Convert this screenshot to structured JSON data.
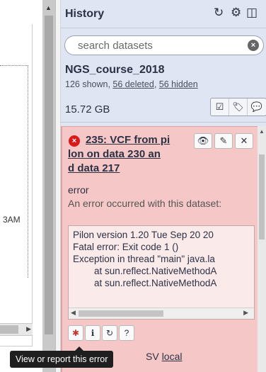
{
  "center": {
    "partial_label": "3AM"
  },
  "history": {
    "title": "History",
    "icons": {
      "refresh": "↻",
      "settings": "⚙",
      "columns": "◫"
    },
    "search": {
      "placeholder": "search datasets",
      "clear": "×"
    },
    "name": "NGS_course_2018",
    "counts": {
      "shown": "126 shown, ",
      "deleted": "56 deleted",
      "sep": ", ",
      "hidden": "56 hidden"
    },
    "size": "15.72 GB",
    "action_icons": {
      "select": "☑",
      "tags": "🏷",
      "annotate": "💬"
    }
  },
  "dataset": {
    "error_icon": "×",
    "title_line1": "235: VCF from pi",
    "title_line2": "lon on data 230 an",
    "title_line3": "d data 217",
    "action_icons": {
      "view": "👁",
      "edit": "✎",
      "delete": "✕"
    },
    "state": "error",
    "message": "An error occurred with this dataset:",
    "peek_lines": [
      "Pilon version 1.20 Tue Sep 20 20",
      "Fatal error: Exit code 1 ()",
      "Exception in thread \"main\" java.la",
      "        at sun.reflect.NativeMethodA",
      "        at sun.reflect.NativeMethodA"
    ],
    "tool_icons": {
      "report": "✱",
      "info": "ℹ",
      "rerun": "↻",
      "help": "?"
    },
    "display_prefix": "SV",
    "display_link": "local"
  },
  "tooltip": "View or report this error",
  "colors": {
    "panel": "#dfe5f2",
    "error_bg": "#f5c7c7",
    "error_icon": "#d91a1a"
  }
}
